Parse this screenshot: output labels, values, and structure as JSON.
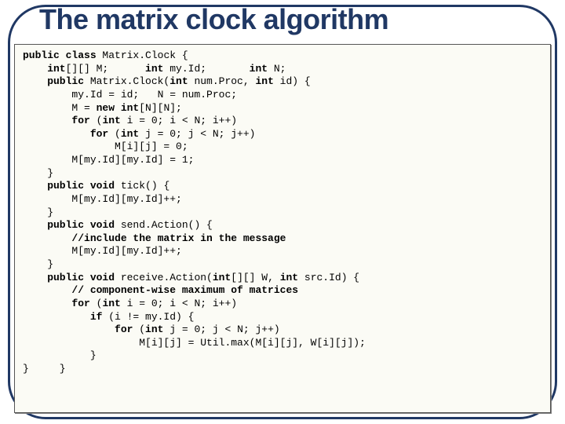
{
  "title": "The matrix clock algorithm",
  "code": {
    "l01a": "public",
    "l01b": " class",
    "l01c": " Matrix.Clock {",
    "l02a": "    int",
    "l02b": "[][] M;      ",
    "l02c": "int",
    "l02d": " my.Id;       ",
    "l02e": "int",
    "l02f": " N;",
    "l03a": "    public",
    "l03b": " Matrix.Clock(",
    "l03c": "int",
    "l03d": " num.Proc, ",
    "l03e": "int",
    "l03f": " id) {",
    "l04": "        my.Id = id;   N = num.Proc;",
    "l05a": "        M = ",
    "l05b": "new int",
    "l05c": "[N][N];",
    "l06a": "        for",
    "l06b": " (",
    "l06c": "int",
    "l06d": " i = 0; i < N; i++)",
    "l07a": "           for",
    "l07b": " (",
    "l07c": "int",
    "l07d": " j = 0; j < N; j++)",
    "l08": "               M[i][j] = 0;",
    "l09": "        M[my.Id][my.Id] = 1;",
    "l10": "    }",
    "l11a": "    public void",
    "l11b": " tick() {",
    "l12": "        M[my.Id][my.Id]++;",
    "l13": "    }",
    "l14a": "    public void",
    "l14b": " send.Action() {",
    "l15": "        //include the matrix in the message",
    "l16": "        M[my.Id][my.Id]++;",
    "l17": "    }",
    "l18a": "    public void",
    "l18b": " receive.Action(",
    "l18c": "int",
    "l18d": "[][] W, ",
    "l18e": "int",
    "l18f": " src.Id) {",
    "l19": "        // component-wise maximum of matrices",
    "l20a": "        for",
    "l20b": " (",
    "l20c": "int",
    "l20d": " i = 0; i < N; i++)",
    "l21a": "           if",
    "l21b": " (i != my.Id) {",
    "l22a": "               for",
    "l22b": " (",
    "l22c": "int",
    "l22d": " j = 0; j < N; j++)",
    "l23": "                   M[i][j] = Util.max(M[i][j], W[i][j]);",
    "l24": "           }",
    "l25": "}     }"
  }
}
